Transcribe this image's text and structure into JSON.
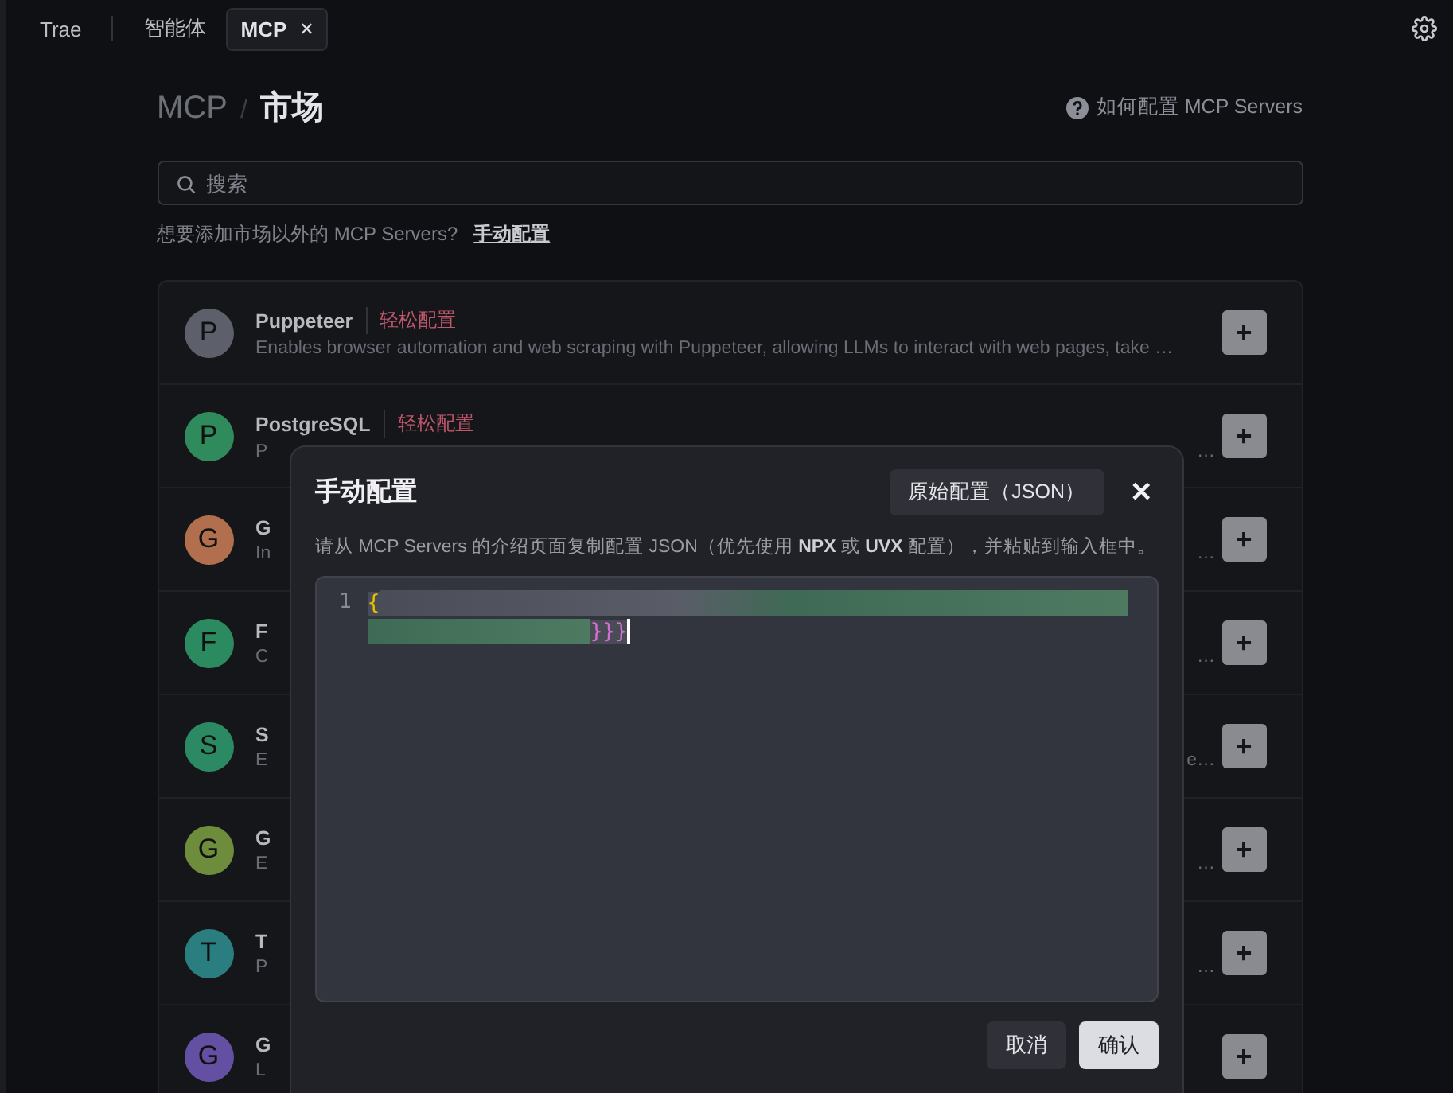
{
  "tabs": [
    {
      "label": "Trae",
      "selected": false,
      "closable": false
    },
    {
      "label": "智能体",
      "selected": false,
      "closable": false
    },
    {
      "label": "MCP",
      "selected": true,
      "closable": true,
      "close_glyph": "✕"
    }
  ],
  "breadcrumb": {
    "parent": "MCP",
    "separator": "/",
    "current": "市场"
  },
  "help_link": "如何配置 MCP Servers",
  "search": {
    "placeholder": "搜索"
  },
  "hint": {
    "text": "想要添加市场以外的 MCP Servers?",
    "link": "手动配置"
  },
  "servers": [
    {
      "letter": "P",
      "color": "#5d5f6b",
      "name": "Puppeteer",
      "tag": "轻松配置",
      "description": "Enables browser automation and web scraping with Puppeteer, allowing LLMs to interact with web pages, take …",
      "add": "+"
    },
    {
      "letter": "P",
      "color": "#2f8a5c",
      "name": "PostgreSQL",
      "tag": "轻松配置",
      "description": "P",
      "description_end": "…",
      "add": "+"
    },
    {
      "letter": "G",
      "color": "#b26f4d",
      "name": "G",
      "description": "In",
      "description_end": "…",
      "add": "+"
    },
    {
      "letter": "F",
      "color": "#2b8a5f",
      "name": "F",
      "description": "C",
      "description_end": "…",
      "add": "+"
    },
    {
      "letter": "S",
      "color": "#2b8a63",
      "name": "S",
      "description": "E",
      "description_end": "e…",
      "add": "+"
    },
    {
      "letter": "G",
      "color": "#6e8d3c",
      "name": "G",
      "description": "E",
      "description_end": "…",
      "add": "+"
    },
    {
      "letter": "T",
      "color": "#2b7e80",
      "name": "T",
      "description": "P",
      "description_end": "…",
      "add": "+"
    },
    {
      "letter": "G",
      "color": "#6450a2",
      "name": "G",
      "description": "L",
      "add": "+"
    }
  ],
  "dialog": {
    "title": "手动配置",
    "raw_button": "原始配置（JSON）",
    "close_glyph": "✕",
    "instruction": "请从 MCP Servers 的介绍页面复制配置 JSON（优先使用 **NPX** 或 **UVX** 配置），并粘贴到输入框中。",
    "editor": {
      "line_number": "1",
      "open_brace": "{",
      "close_braces": "}}}"
    },
    "buttons": [
      {
        "label": "取消",
        "kind": "secondary"
      },
      {
        "label": "确认",
        "kind": "primary"
      }
    ]
  }
}
